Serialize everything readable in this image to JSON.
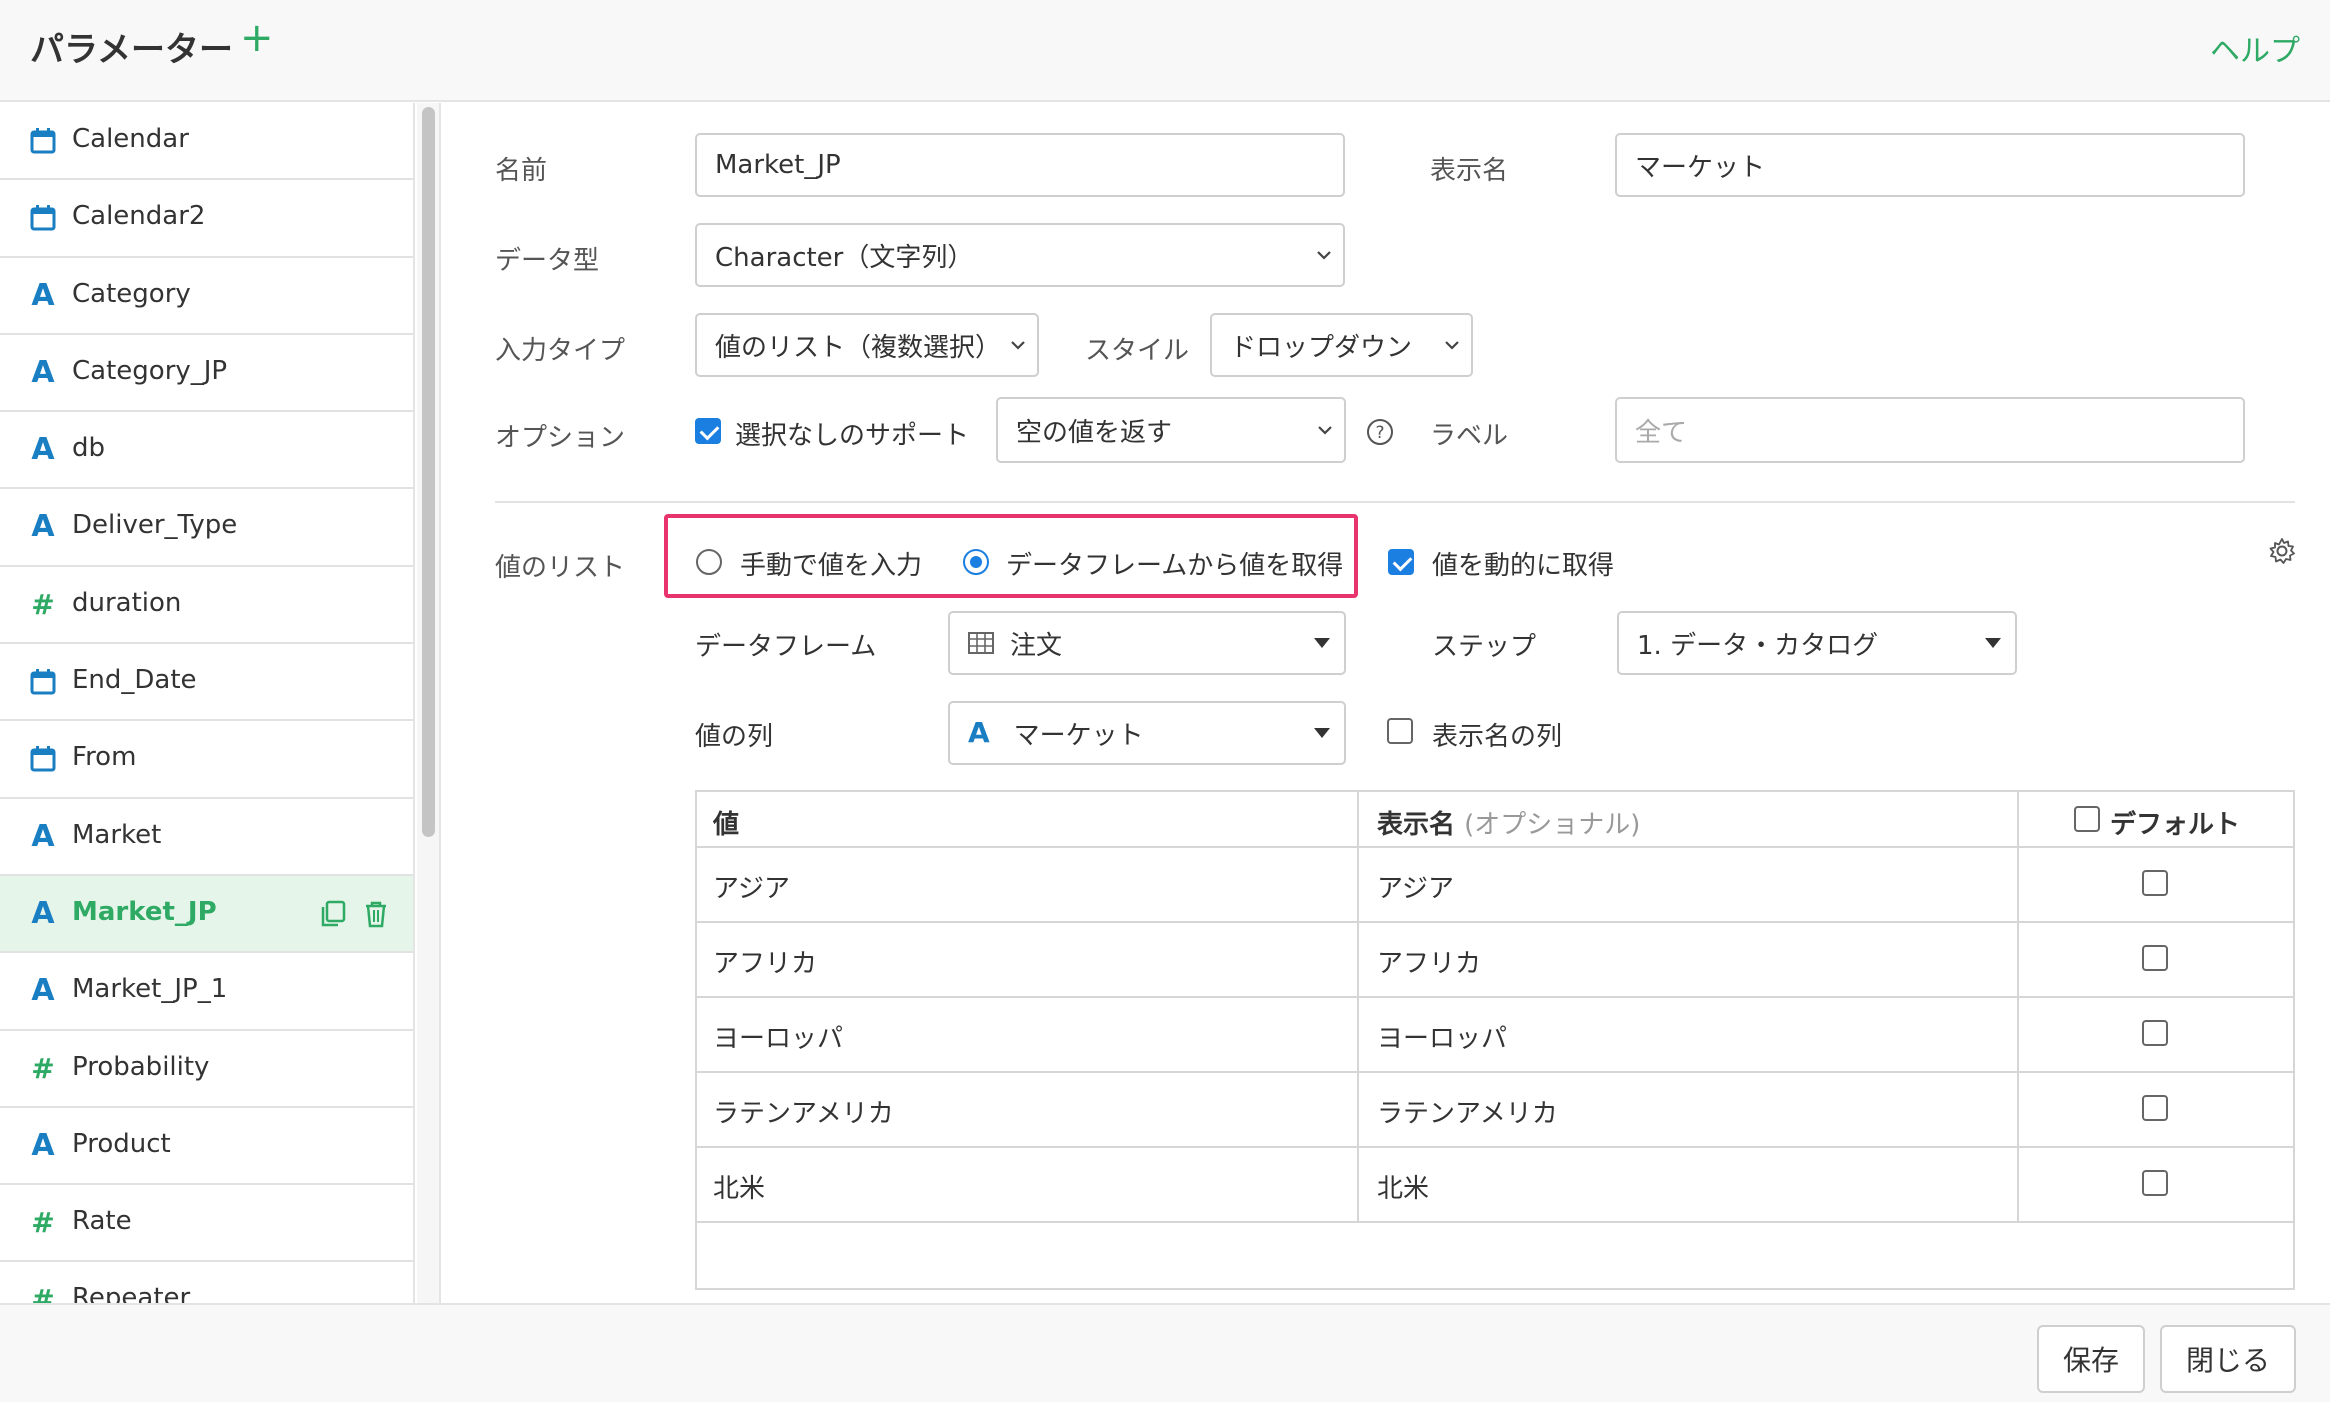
{
  "header": {
    "title": "パラメーター",
    "add_icon": "plus-icon",
    "help": "ヘルプ"
  },
  "sidebar": {
    "items": [
      {
        "icon": "calendar-icon",
        "label": "Calendar"
      },
      {
        "icon": "calendar-icon",
        "label": "Calendar2"
      },
      {
        "icon": "character-icon",
        "label": "Category"
      },
      {
        "icon": "character-icon",
        "label": "Category_JP"
      },
      {
        "icon": "character-icon",
        "label": "db"
      },
      {
        "icon": "character-icon",
        "label": "Deliver_Type"
      },
      {
        "icon": "number-icon",
        "label": "duration"
      },
      {
        "icon": "calendar-icon",
        "label": "End_Date"
      },
      {
        "icon": "calendar-icon",
        "label": "From"
      },
      {
        "icon": "character-icon",
        "label": "Market"
      },
      {
        "icon": "character-icon",
        "label": "Market_JP",
        "active": true
      },
      {
        "icon": "character-icon",
        "label": "Market_JP_1"
      },
      {
        "icon": "number-icon",
        "label": "Probability"
      },
      {
        "icon": "character-icon",
        "label": "Product"
      },
      {
        "icon": "number-icon",
        "label": "Rate"
      },
      {
        "icon": "number-icon",
        "label": "Repeater"
      }
    ]
  },
  "form": {
    "name_label": "名前",
    "name_value": "Market_JP",
    "display_name_label": "表示名",
    "display_name_value": "マーケット",
    "data_type_label": "データ型",
    "data_type_value": "Character（文字列）",
    "input_type_label": "入力タイプ",
    "input_type_value": "値のリスト（複数選択）",
    "style_label": "スタイル",
    "style_value": "ドロップダウン",
    "option_label": "オプション",
    "no_selection_label": "選択なしのサポート",
    "no_selection_checked": true,
    "empty_value_option": "空の値を返す",
    "label_label": "ラベル",
    "label_placeholder": "全て",
    "value_list_label": "値のリスト",
    "radio_manual": "手動で値を入力",
    "radio_dataframe": "データフレームから値を取得",
    "selected_source": "dataframe",
    "dynamic_label": "値を動的に取得",
    "dynamic_checked": true,
    "dataframe_label": "データフレーム",
    "dataframe_value": "注文",
    "step_label": "ステップ",
    "step_value": "1. データ・カタログ",
    "value_column_label": "値の列",
    "value_column_value": "マーケット",
    "display_column_label": "表示名の列",
    "display_column_checked": false
  },
  "table": {
    "col_value": "値",
    "col_display": "表示名",
    "col_display_sub": "(オプショナル)",
    "col_default": "デフォルト",
    "rows": [
      {
        "value": "アジア",
        "display": "アジア",
        "default": false
      },
      {
        "value": "アフリカ",
        "display": "アフリカ",
        "default": false
      },
      {
        "value": "ヨーロッパ",
        "display": "ヨーロッパ",
        "default": false
      },
      {
        "value": "ラテンアメリカ",
        "display": "ラテンアメリカ",
        "default": false
      },
      {
        "value": "北米",
        "display": "北米",
        "default": false
      }
    ]
  },
  "footer": {
    "save": "保存",
    "close": "閉じる"
  },
  "colors": {
    "accent_green": "#2eaa65",
    "accent_blue": "#1a7fe0",
    "highlight": "#e8336d",
    "char_icon_blue": "#1a7ec2"
  }
}
